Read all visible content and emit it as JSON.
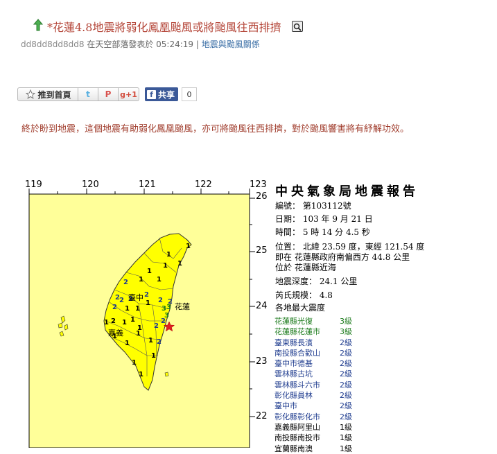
{
  "post": {
    "title": "*花蓮4.8地震將弱化鳳凰颱風或將颱風往西排擠",
    "author": "dd8dd8dd8dd8",
    "meta_text": "在天空部落發表於 05:24:19",
    "separator": "|",
    "category": "地震與颱風關係"
  },
  "share": {
    "recommend_label": "推到首頁",
    "twitter_label": "t",
    "plurk_label": "P",
    "gplus_label": "g+1",
    "fb_label": "共享",
    "fb_count": "0"
  },
  "article": {
    "text": "終於盼到地震，這個地震有助弱化鳳凰颱風，亦可將颱風往西排擠，對於颱風響害將有紓解功效。"
  },
  "report": {
    "title": "中央氣象局地震報告",
    "number": "編號： 第103112號",
    "date": "日期： 103 年 9 月 21 日",
    "time": "時間： 5 時 14 分 4.5 秒",
    "position": "位置： 北緯 23.59 度，東經 121.54 度",
    "location1": "即在 花蓮縣政府南偏西方 44.8 公里",
    "location2": "位於 花蓮縣近海",
    "depth": "地震深度： 24.1 公里",
    "magnitude": "芮氏規模： 4.8",
    "intensity_header": "各地最大震度",
    "intensities": [
      {
        "place": "花蓮縣光復",
        "level": "3級",
        "color": "#1a7a1a"
      },
      {
        "place": "花蓮縣花蓮市",
        "level": "3級",
        "color": "#1a7a1a"
      },
      {
        "place": "臺東縣長濱",
        "level": "2級",
        "color": "#1f3c8f"
      },
      {
        "place": "南投縣合歡山",
        "level": "2級",
        "color": "#1f3c8f"
      },
      {
        "place": "臺中市德基",
        "level": "2級",
        "color": "#1f3c8f"
      },
      {
        "place": "雲林縣古坑",
        "level": "2級",
        "color": "#1f3c8f"
      },
      {
        "place": "雲林縣斗六市",
        "level": "2級",
        "color": "#1f3c8f"
      },
      {
        "place": "彰化縣員林",
        "level": "2級",
        "color": "#1f3c8f"
      },
      {
        "place": "臺中市",
        "level": "2級",
        "color": "#1f3c8f"
      },
      {
        "place": "彰化縣彰化市",
        "level": "2級",
        "color": "#1f3c8f"
      },
      {
        "place": "嘉義縣阿里山",
        "level": "1級",
        "color": "#000000"
      },
      {
        "place": "南投縣南投市",
        "level": "1級",
        "color": "#000000"
      },
      {
        "place": "宜蘭縣南澳",
        "level": "1級",
        "color": "#000000"
      }
    ]
  },
  "map": {
    "lon_ticks": [
      "119",
      "120",
      "121",
      "122",
      "123"
    ],
    "lat_ticks": [
      "26",
      "25",
      "24",
      "23",
      "22"
    ],
    "city_labels": {
      "taichung": "臺中",
      "hualien": "花蓮",
      "chiayi": "嘉義"
    },
    "sea_color": "#ffff99",
    "land_color": "#ffff00",
    "ocean_color": "#ffffff",
    "epicenter_color": "#e02020"
  }
}
